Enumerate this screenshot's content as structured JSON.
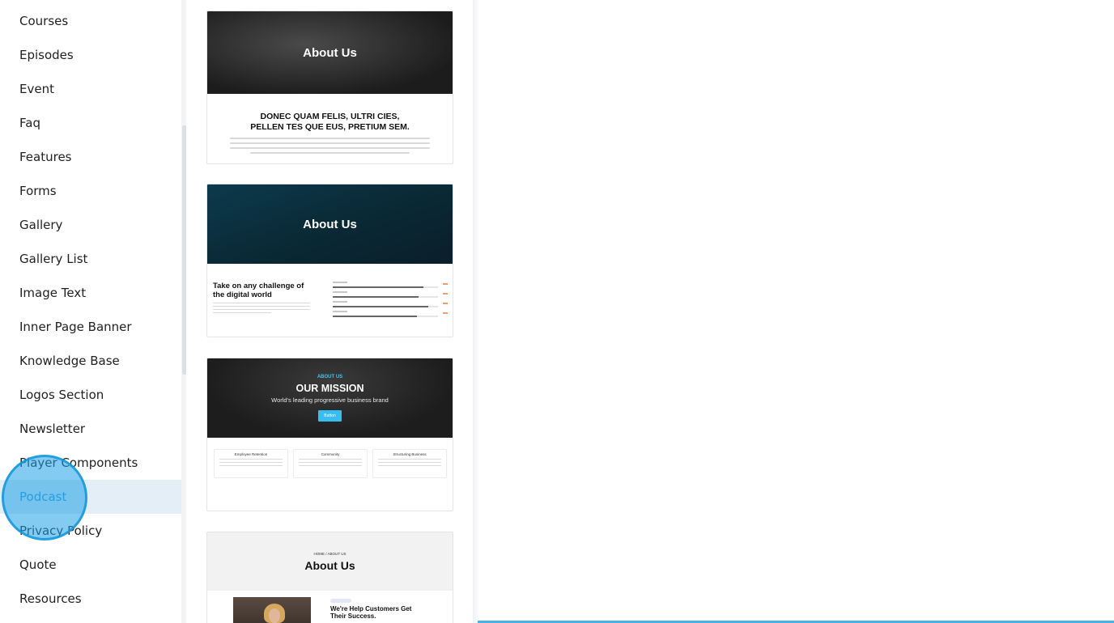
{
  "sidebar": {
    "items": [
      {
        "label": "Courses"
      },
      {
        "label": "Episodes"
      },
      {
        "label": "Event"
      },
      {
        "label": "Faq"
      },
      {
        "label": "Features"
      },
      {
        "label": "Forms"
      },
      {
        "label": "Gallery"
      },
      {
        "label": "Gallery List"
      },
      {
        "label": "Image Text"
      },
      {
        "label": "Inner Page Banner"
      },
      {
        "label": "Knowledge Base"
      },
      {
        "label": "Logos Section"
      },
      {
        "label": "Newsletter"
      },
      {
        "label": "Player Components"
      },
      {
        "label": "Podcast",
        "active": true
      },
      {
        "label": "Privacy Policy"
      },
      {
        "label": "Quote"
      },
      {
        "label": "Resources"
      }
    ]
  },
  "templates": [
    {
      "hero_title": "About Us",
      "headline_line1": "DONEC QUAM FELIS, ULTRI CIES,",
      "headline_line2": "PELLEN TES QUE EUS, PRETIUM SEM."
    },
    {
      "hero_title": "About Us",
      "heading_line1": "Take on any challenge of",
      "heading_line2": "the digital world"
    },
    {
      "eyebrow": "ABOUT US",
      "hero_title": "OUR MISSION",
      "subtitle": "World's leading progressive business brand",
      "button_label": "Button",
      "columns": [
        "Employee Retention",
        "Community",
        "Structuring Business"
      ]
    },
    {
      "breadcrumb": "HOME / ABOUT US",
      "hero_title": "About Us",
      "heading_line1": "We're Help Customers Get",
      "heading_line2": "Their Success."
    }
  ],
  "colors": {
    "accent": "#2f9be0",
    "active_bg": "#e3eef7",
    "cursor": "#1ea0e6"
  },
  "icons": {
    "cursor": "click-indicator-icon"
  }
}
